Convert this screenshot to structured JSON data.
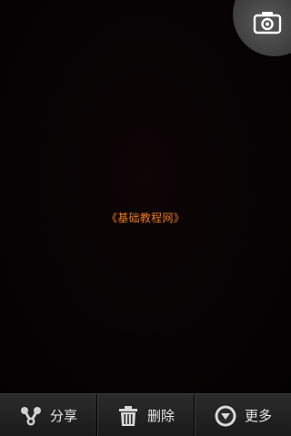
{
  "viewer": {
    "caption": "《基础教程网》"
  },
  "camera_button": {
    "icon": "camera-icon"
  },
  "bottom_bar": {
    "share_label": "分享",
    "share_icon": "share-icon",
    "delete_label": "删除",
    "delete_icon": "trash-icon",
    "more_label": "更多",
    "more_icon": "chevron-down-circle-icon"
  }
}
